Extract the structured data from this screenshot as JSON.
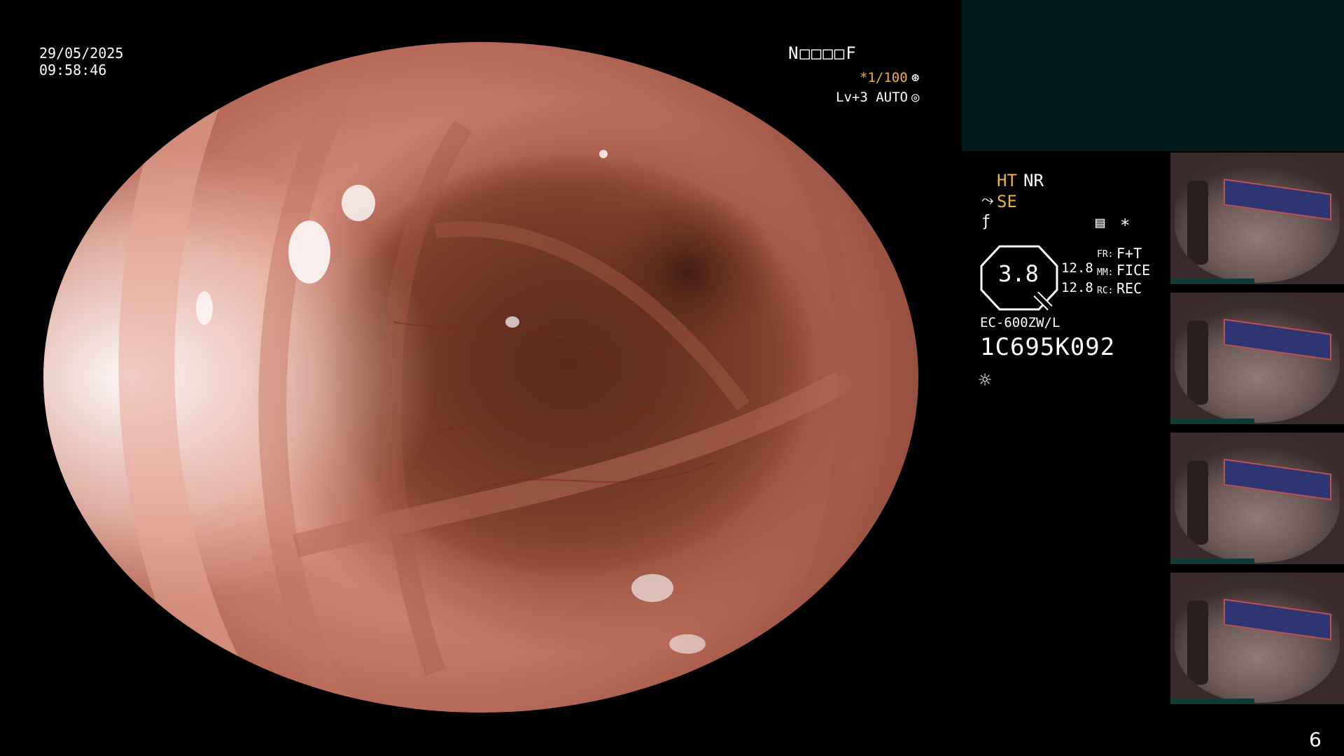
{
  "datetime": {
    "date": "29/05/2025",
    "time": "09:58:46"
  },
  "osd": {
    "top_code": "N□□□□F",
    "shutter": "*1/100",
    "shutter_icon": "aperture-icon",
    "level": "Lv+3 AUTO",
    "auto_icon": "auto-iris-icon"
  },
  "settings": {
    "ht": "HT",
    "nr": "NR",
    "se": "SE",
    "se_icon": "structure-enhance-icon",
    "fn_icon": "function-icon",
    "grid_icon": "memo-icon",
    "star": "*",
    "gauge_value": "3.8",
    "val_a": "12.8",
    "val_b": "12.8",
    "fr_label": "FR:",
    "fr_value": "F+T",
    "mm_label": "MM:",
    "mm_value": "FICE",
    "rc_label": "RC:",
    "rc_value": "REC",
    "model": "EC-600ZW/L",
    "serial": "1C695K092",
    "light_icon": "light-icon"
  },
  "thumbnails": [
    {
      "name": "thumbnail-1"
    },
    {
      "name": "thumbnail-2"
    },
    {
      "name": "thumbnail-3"
    },
    {
      "name": "thumbnail-4"
    }
  ],
  "page_number": "6",
  "colors": {
    "accent": "#f0b040",
    "panel": "#021a19",
    "background": "#000000"
  }
}
